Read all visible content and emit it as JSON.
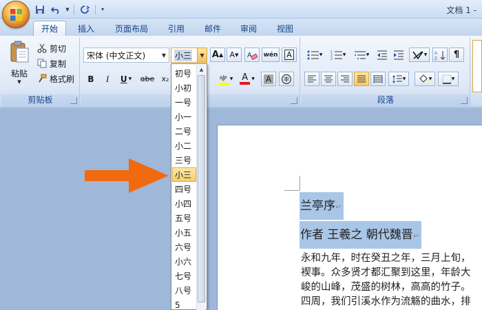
{
  "title_bar": {
    "document_title": "文档 1 -"
  },
  "tabs": [
    {
      "label": "开始",
      "active": true
    },
    {
      "label": "插入"
    },
    {
      "label": "页面布局"
    },
    {
      "label": "引用"
    },
    {
      "label": "邮件"
    },
    {
      "label": "审阅"
    },
    {
      "label": "视图"
    }
  ],
  "clipboard": {
    "paste_label": "粘贴",
    "cut_label": "剪切",
    "copy_label": "复制",
    "format_painter_label": "格式刷",
    "group_label": "剪贴板"
  },
  "font": {
    "font_name": "宋体 (中文正文)",
    "font_size": "小三",
    "grow_label": "A",
    "shrink_label": "A",
    "phonetic_label": "wén",
    "bold_label": "B",
    "italic_label": "I",
    "underline_label": "U",
    "strike_label": "abe",
    "subscript_label": "x₂",
    "font_color_label": "A",
    "char_shading_label": "A",
    "enclose_label": "字"
  },
  "paragraph": {
    "group_label": "段落"
  },
  "size_dropdown": {
    "items": [
      "初号",
      "小初",
      "一号",
      "小一",
      "二号",
      "小二",
      "三号",
      "小三",
      "四号",
      "小四",
      "五号",
      "小五",
      "六号",
      "小六",
      "七号",
      "八号",
      "5"
    ],
    "selected": "小三"
  },
  "document": {
    "title": "兰亭序",
    "author_line": "作者 王羲之 朝代魏晋",
    "para_mark": "↵",
    "body_lines": [
      "永和九年，时在癸丑之年，三月上旬，",
      "褉事。众多贤才都汇聚到这里，年龄大",
      "峻的山峰，茂盛的树林，高高的竹子。",
      "四周，我们引溪水作为流觞的曲水，排"
    ]
  },
  "colors": {
    "highlight": "#ffff00",
    "font_color": "#e0161b",
    "selection": "#a8c6e7",
    "arrow": "#f26a10"
  }
}
